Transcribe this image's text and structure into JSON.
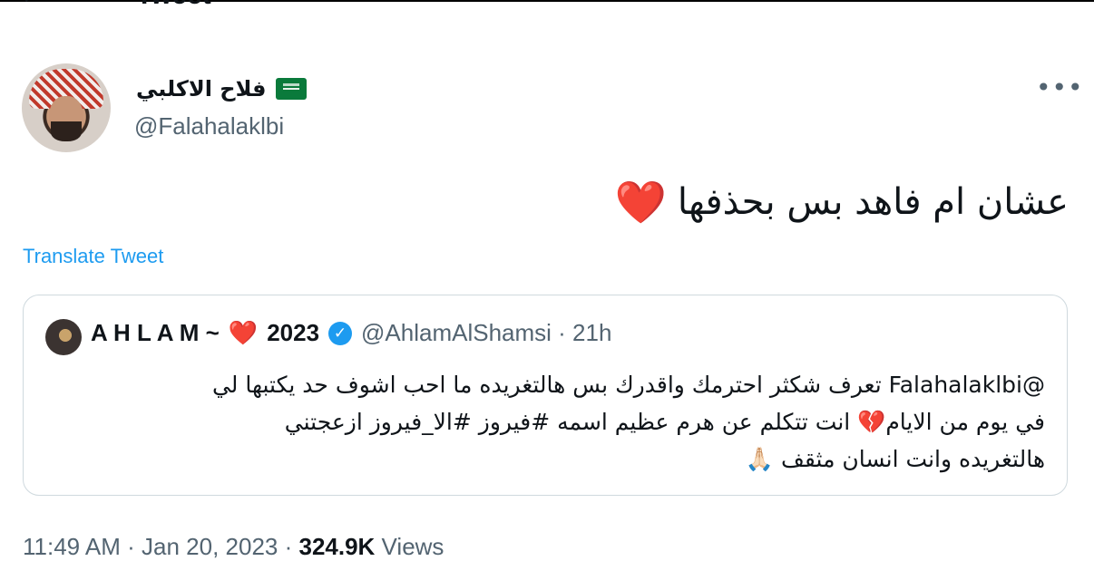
{
  "header": {
    "title": "Tweet",
    "back_icon": "arrow-left-icon"
  },
  "author": {
    "display_name": "فلاح الاكلبي",
    "flag_icon": "saudi-flag-icon",
    "handle": "@Falahalaklbi"
  },
  "more_label": "•••",
  "tweet": {
    "text": "عشان ام فاهد بس بحذفها",
    "emoji": "❤️"
  },
  "translate_label": "Translate Tweet",
  "quote": {
    "name": "A H L A M ~",
    "heart": "❤️",
    "year": "2023",
    "verified_icon": "✓",
    "handle_time": "@AhlamAlShamsi · 21h",
    "line1": "@Falahalaklbi تعرف شكثر احترمك واقدرك بس هالتغريده ما احب اشوف حد يكتبها لي",
    "line2": "في يوم من الايام💔 انت تتكلم عن هرم عظيم اسمه #فيروز  #الا_فيروز  ازعجتني",
    "line3": "هالتغريده وانت انسان مثقف 🙏🏻"
  },
  "meta": {
    "timestamp": "11:49 AM · Jan 20, 2023 · ",
    "views_count": "324.9K",
    "views_label": " Views"
  },
  "colors": {
    "accent": "#1d9bf0",
    "heart": "#e0245e",
    "muted": "#536471"
  }
}
